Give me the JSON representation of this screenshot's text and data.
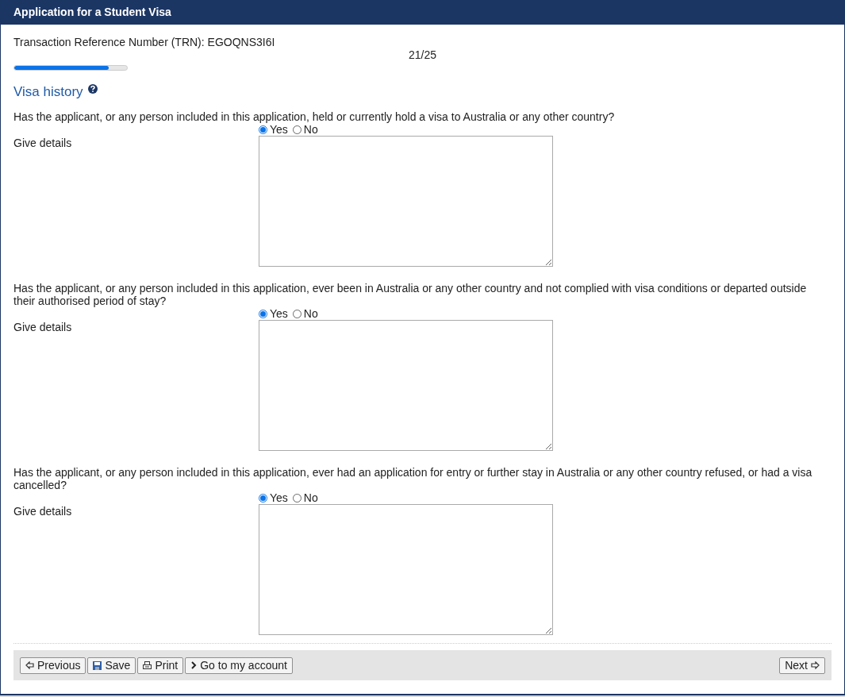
{
  "window": {
    "title": "Application for a Student Visa"
  },
  "trn": "Transaction Reference Number (TRN): EGOQNS3I6I",
  "progress": {
    "reading": "21/25",
    "level": 0.84
  },
  "section": {
    "title": "Visa history"
  },
  "questions": [
    {
      "text": "Has the applicant, or any person included in this application, held or currently hold a visa to Australia or any other country?",
      "options": [
        {
          "label": "Yes",
          "selected": true
        },
        {
          "label": "No",
          "selected": false
        }
      ],
      "details_label": "Give details"
    },
    {
      "text": "Has the applicant, or any person included in this application, ever been in Australia or any other country and not complied with visa conditions or departed outside their authorised period of stay?",
      "options": [
        {
          "label": "Yes",
          "selected": true
        },
        {
          "label": "No",
          "selected": false
        }
      ],
      "details_label": "Give details"
    },
    {
      "text": "Has the applicant, or any person included in this application, ever had an application for entry or further stay in Australia or any other country refused, or had a visa cancelled?",
      "options": [
        {
          "label": "Yes",
          "selected": true
        },
        {
          "label": "No",
          "selected": false
        }
      ],
      "details_label": "Give details"
    }
  ],
  "footer": {
    "left_buttons": [
      {
        "label": "Previous",
        "kind": "previous"
      },
      {
        "label": "Save",
        "kind": "save"
      },
      {
        "label": "Print",
        "kind": "print"
      },
      {
        "label": "Go to my account",
        "kind": "account"
      }
    ],
    "right_buttons": [
      {
        "label": "Next",
        "kind": "next"
      }
    ]
  }
}
